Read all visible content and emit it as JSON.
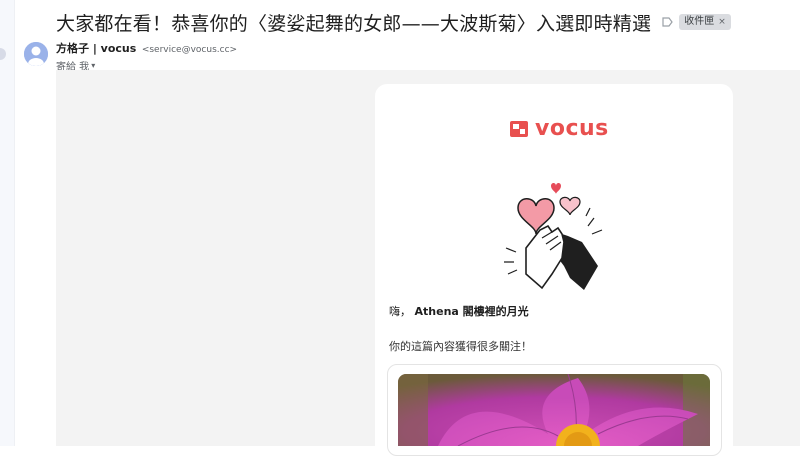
{
  "email": {
    "subject": "大家都在看！恭喜你的〈婆娑起舞的女郎——大波斯菊〉入選即時精選",
    "label_chip": "收件匣",
    "label_chip_close": "×",
    "sender_name": "方格子 | vocus",
    "sender_email": "<service@vocus.cc>",
    "to_line": "寄給 我",
    "to_caret": "▾"
  },
  "body": {
    "logo_text": "vocus",
    "greeting_prefix": "嗨，",
    "greeting_name": "Athena 閣樓裡的月光",
    "notice": "你的這篇內容獲得很多關注！"
  },
  "colors": {
    "brand": "#e8504f",
    "chip_bg": "#dadce0",
    "content_bg": "#f3f3f3"
  },
  "icons": [
    "label-importance-icon",
    "vocus-logo-icon",
    "high-five-hearts-icon",
    "chevron-down-icon",
    "user-avatar-icon"
  ]
}
